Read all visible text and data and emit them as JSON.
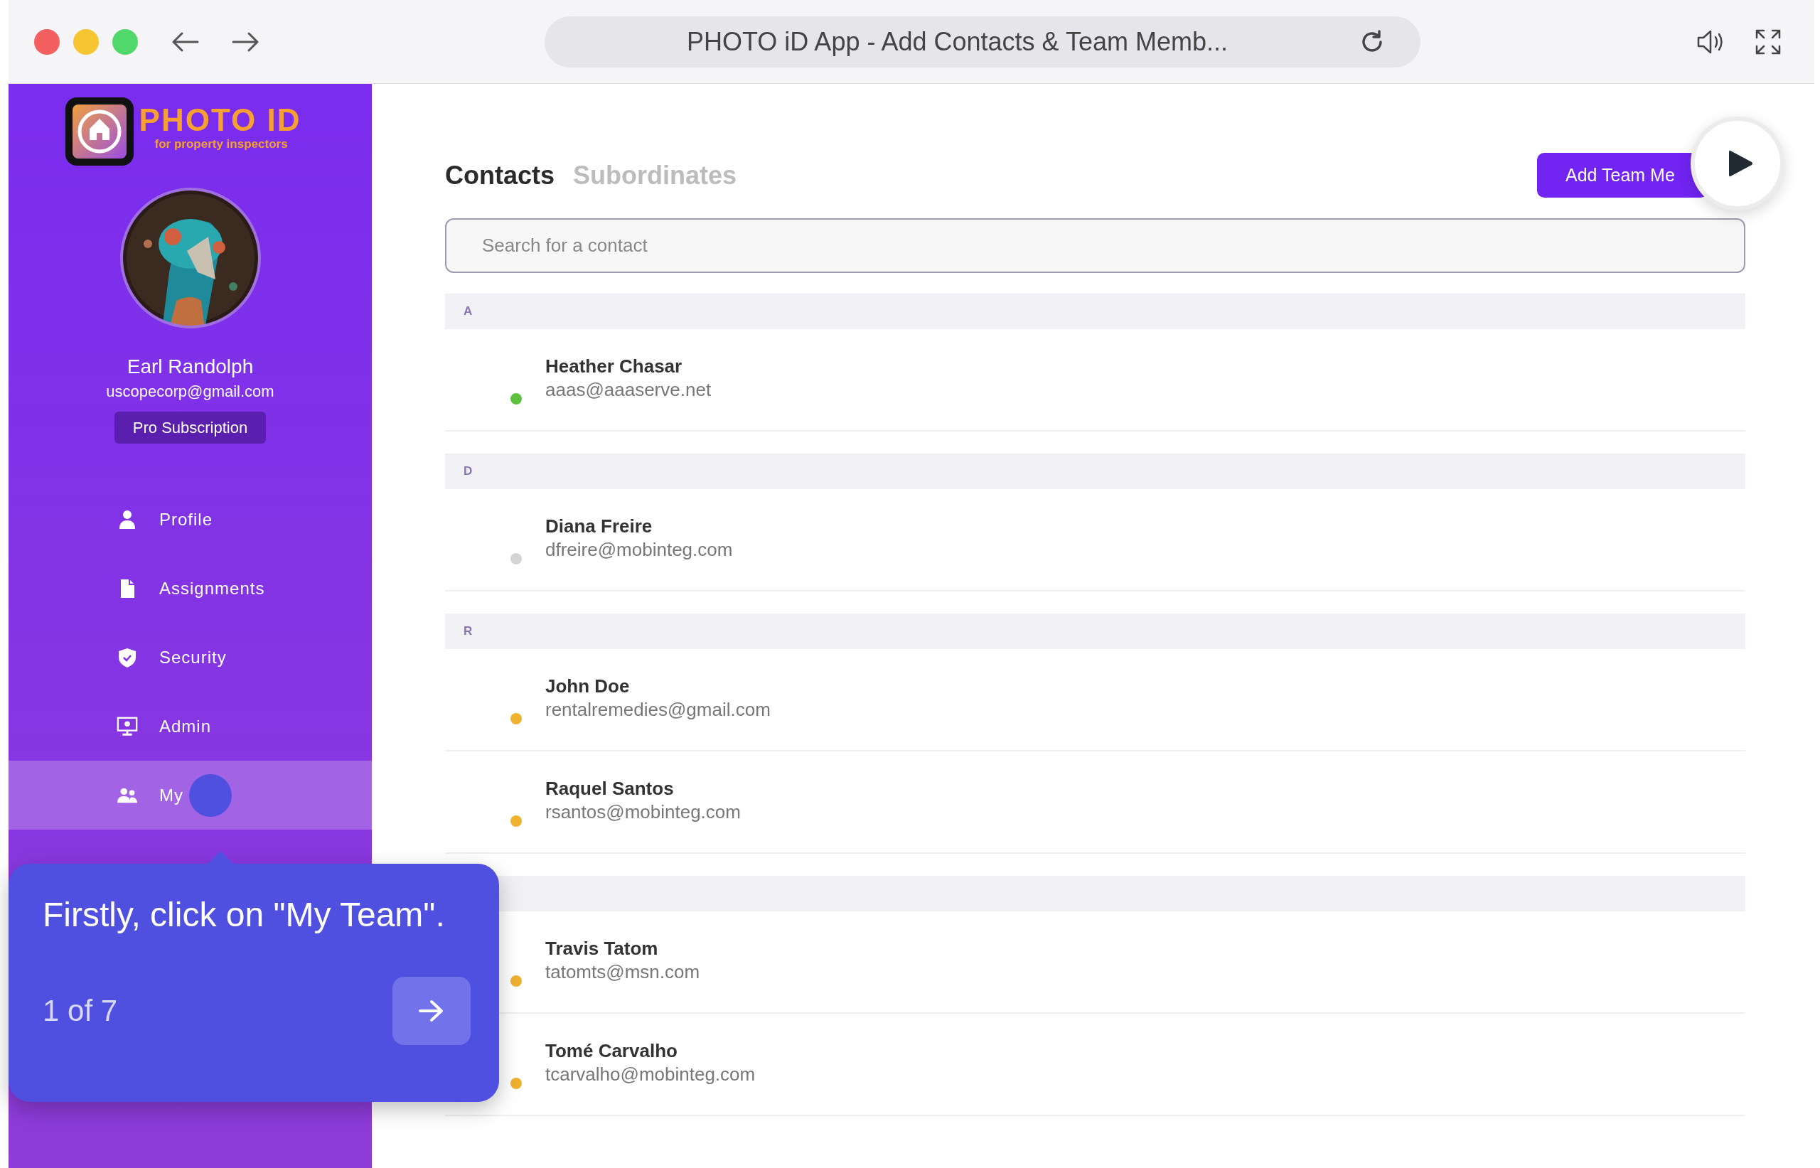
{
  "browser": {
    "title": "PHOTO iD App - Add Contacts & Team Memb..."
  },
  "brand": {
    "name": "PHOTO ID",
    "tagline": "for property inspectors"
  },
  "user": {
    "name": "Earl Randolph",
    "email": "uscopecorp@gmail.com",
    "plan": "Pro Subscription"
  },
  "nav": [
    {
      "kind": "profile",
      "label": "Profile",
      "selected": false
    },
    {
      "kind": "assignments",
      "label": "Assignments",
      "selected": false
    },
    {
      "kind": "security",
      "label": "Security",
      "selected": false
    },
    {
      "kind": "admin",
      "label": "Admin",
      "selected": false
    },
    {
      "kind": "team",
      "label": "My",
      "selected": true
    }
  ],
  "tabs": [
    {
      "label": "Contacts",
      "selected": true
    },
    {
      "label": "Subordinates",
      "selected": false
    }
  ],
  "add_button": "Add Team Me",
  "search": {
    "placeholder": "Search for a contact"
  },
  "sections": [
    {
      "letter": "A",
      "contacts": [
        {
          "name": "Heather Chasar",
          "email": "aaas@aaaserve.net",
          "color": "#5cc13c"
        }
      ]
    },
    {
      "letter": "D",
      "contacts": [
        {
          "name": "Diana Freire",
          "email": "dfreire@mobinteg.com",
          "color": "#d4d4d4"
        }
      ]
    },
    {
      "letter": "R",
      "contacts": [
        {
          "name": "John Doe",
          "email": "rentalremedies@gmail.com",
          "color": "#f0b030"
        },
        {
          "name": "Raquel Santos",
          "email": "rsantos@mobinteg.com",
          "color": "#f0b030"
        }
      ]
    },
    {
      "contacts": [
        {
          "name": "Travis Tatom",
          "email": "tatomts@msn.com",
          "color": "#f0b030"
        },
        {
          "name": "Tomé Carvalho",
          "email": "tcarvalho@mobinteg.com",
          "color": "#f0b030"
        }
      ]
    }
  ],
  "tour": {
    "text": "Firstly, click on \"My Team\".",
    "step": "1 of 7"
  }
}
